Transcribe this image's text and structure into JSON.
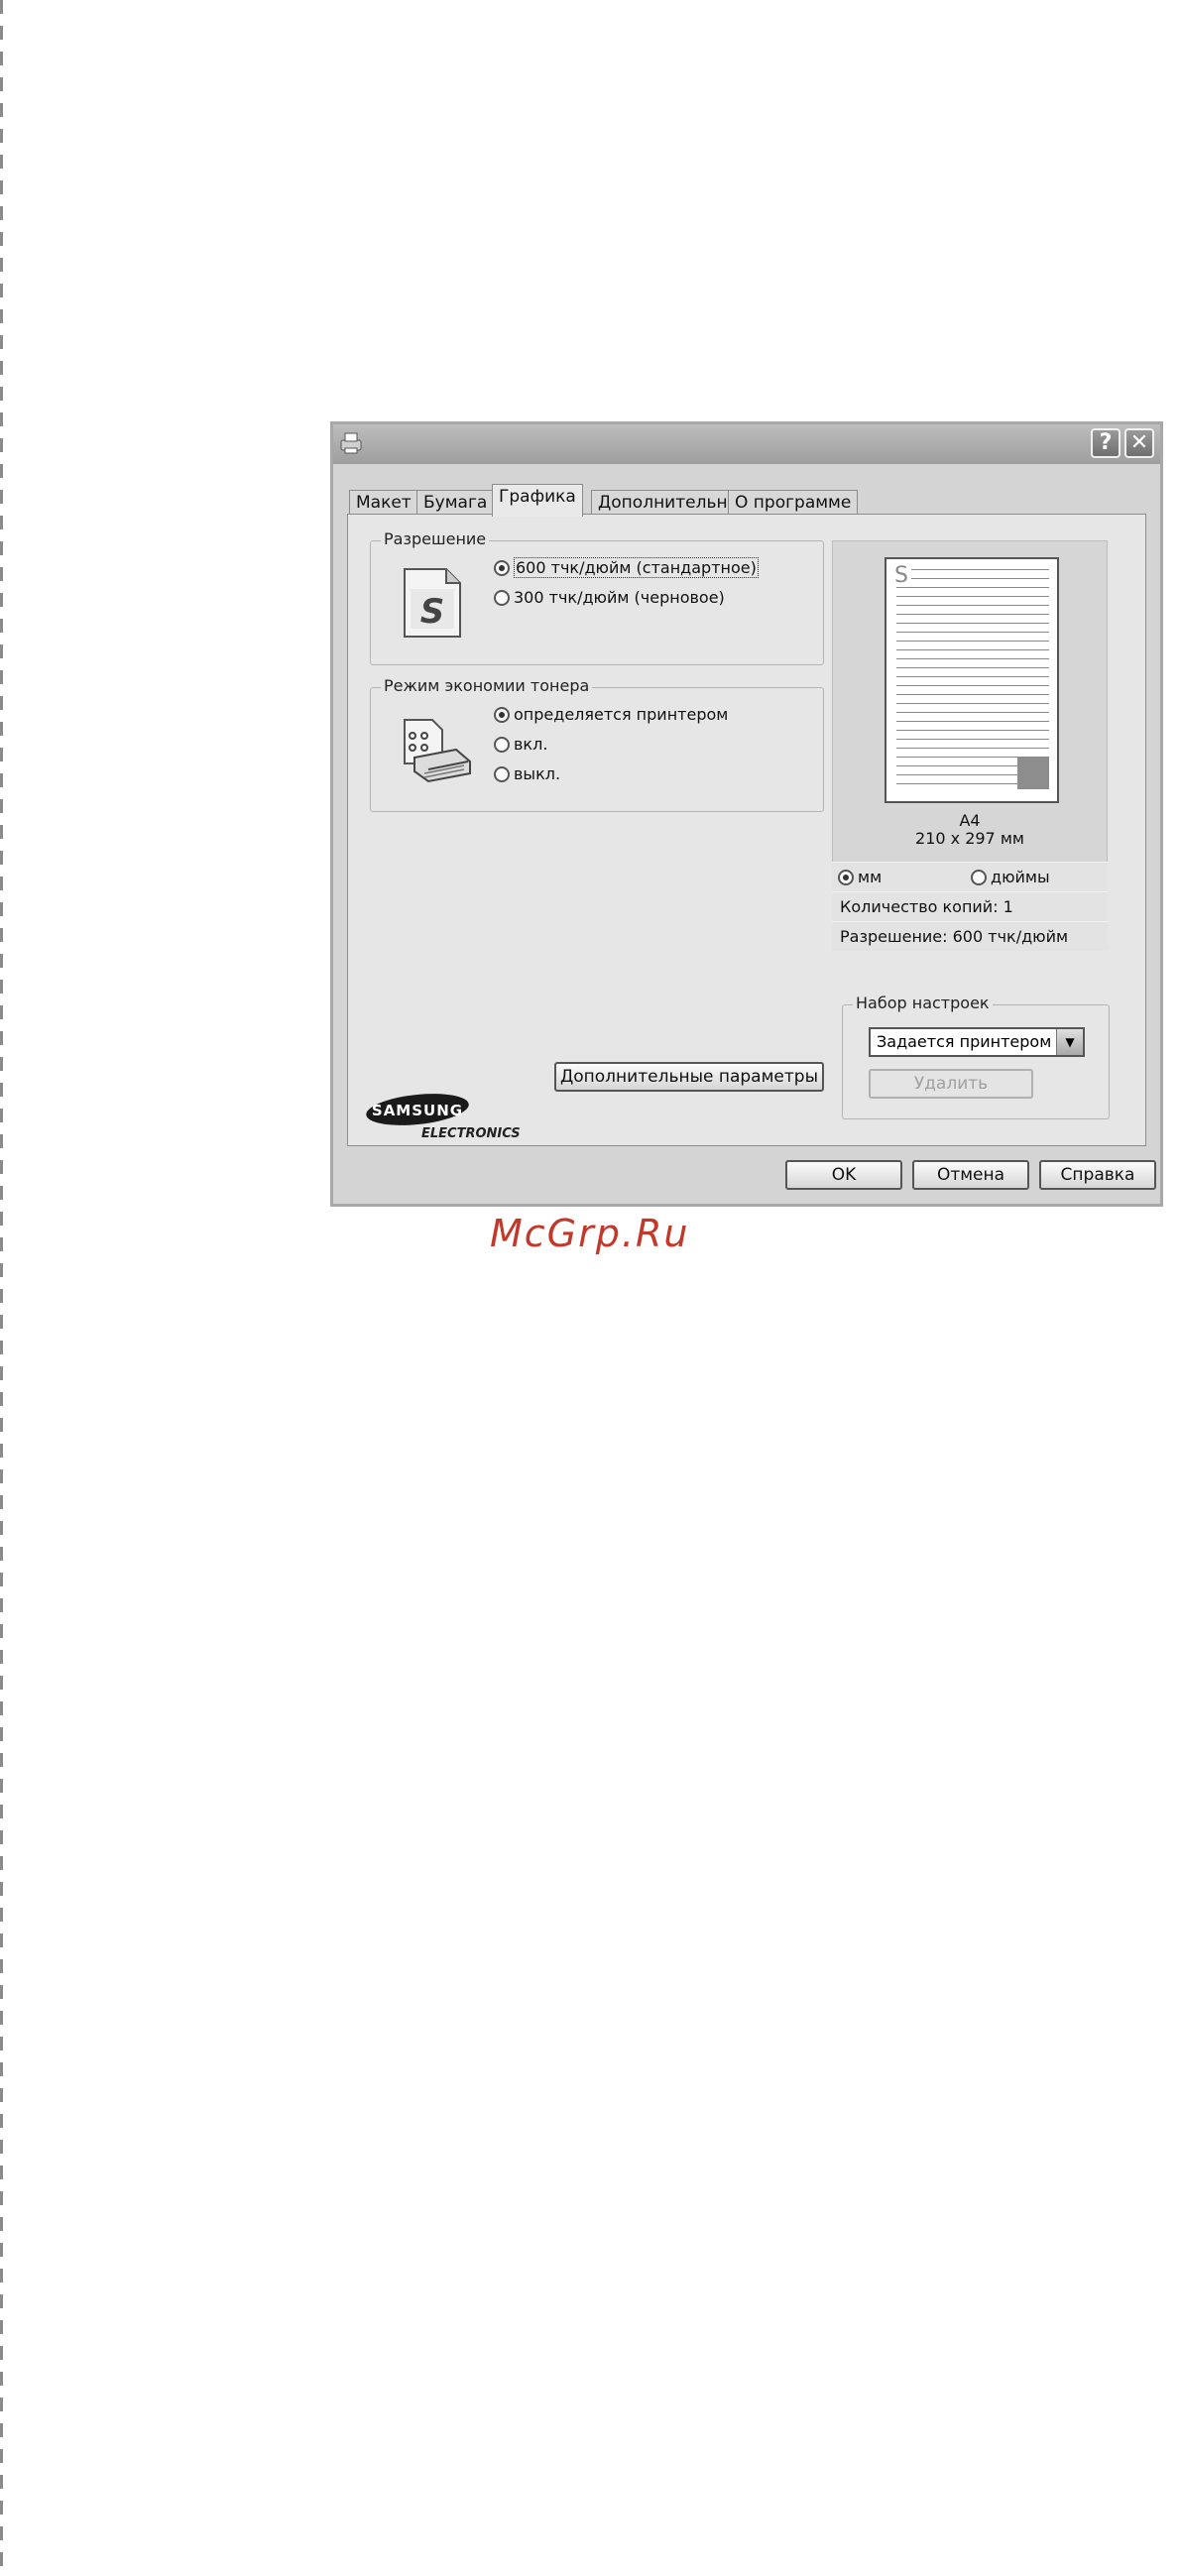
{
  "tabs": [
    "Макет",
    "Бумага",
    "Графика",
    "Дополнительно",
    "О программе"
  ],
  "resolution": {
    "title": "Разрешение",
    "options": [
      "600 тчк/дюйм (стандартное)",
      "300 тчк/дюйм (черновое)"
    ],
    "selected": 0
  },
  "toner_saving": {
    "title": "Режим экономии тонера",
    "options": [
      "определяется принтером",
      "вкл.",
      "выкл."
    ],
    "selected": 0
  },
  "advanced_button": "Дополнительные параметры",
  "preview": {
    "paper_name": "A4",
    "paper_size": "210 x 297 мм",
    "units": [
      "мм",
      "дюймы"
    ],
    "unit_selected": 0,
    "copies": "Количество копий: 1",
    "resolution": "Разрешение: 600 тчк/дюйм"
  },
  "favorites": {
    "title": "Набор настроек",
    "selected": "Задается принтером",
    "delete_button": "Удалить"
  },
  "buttons": {
    "ok": "OK",
    "cancel": "Отмена",
    "help": "Справка"
  },
  "logo": {
    "line1": "SAMSUNG",
    "line2": "ELECTRONICS"
  },
  "watermark": "McGrp.Ru",
  "icons": [
    "printer-icon",
    "help-icon",
    "close-icon",
    "samsung-s-icon",
    "toner-printer-icon",
    "chevron-down-icon"
  ]
}
